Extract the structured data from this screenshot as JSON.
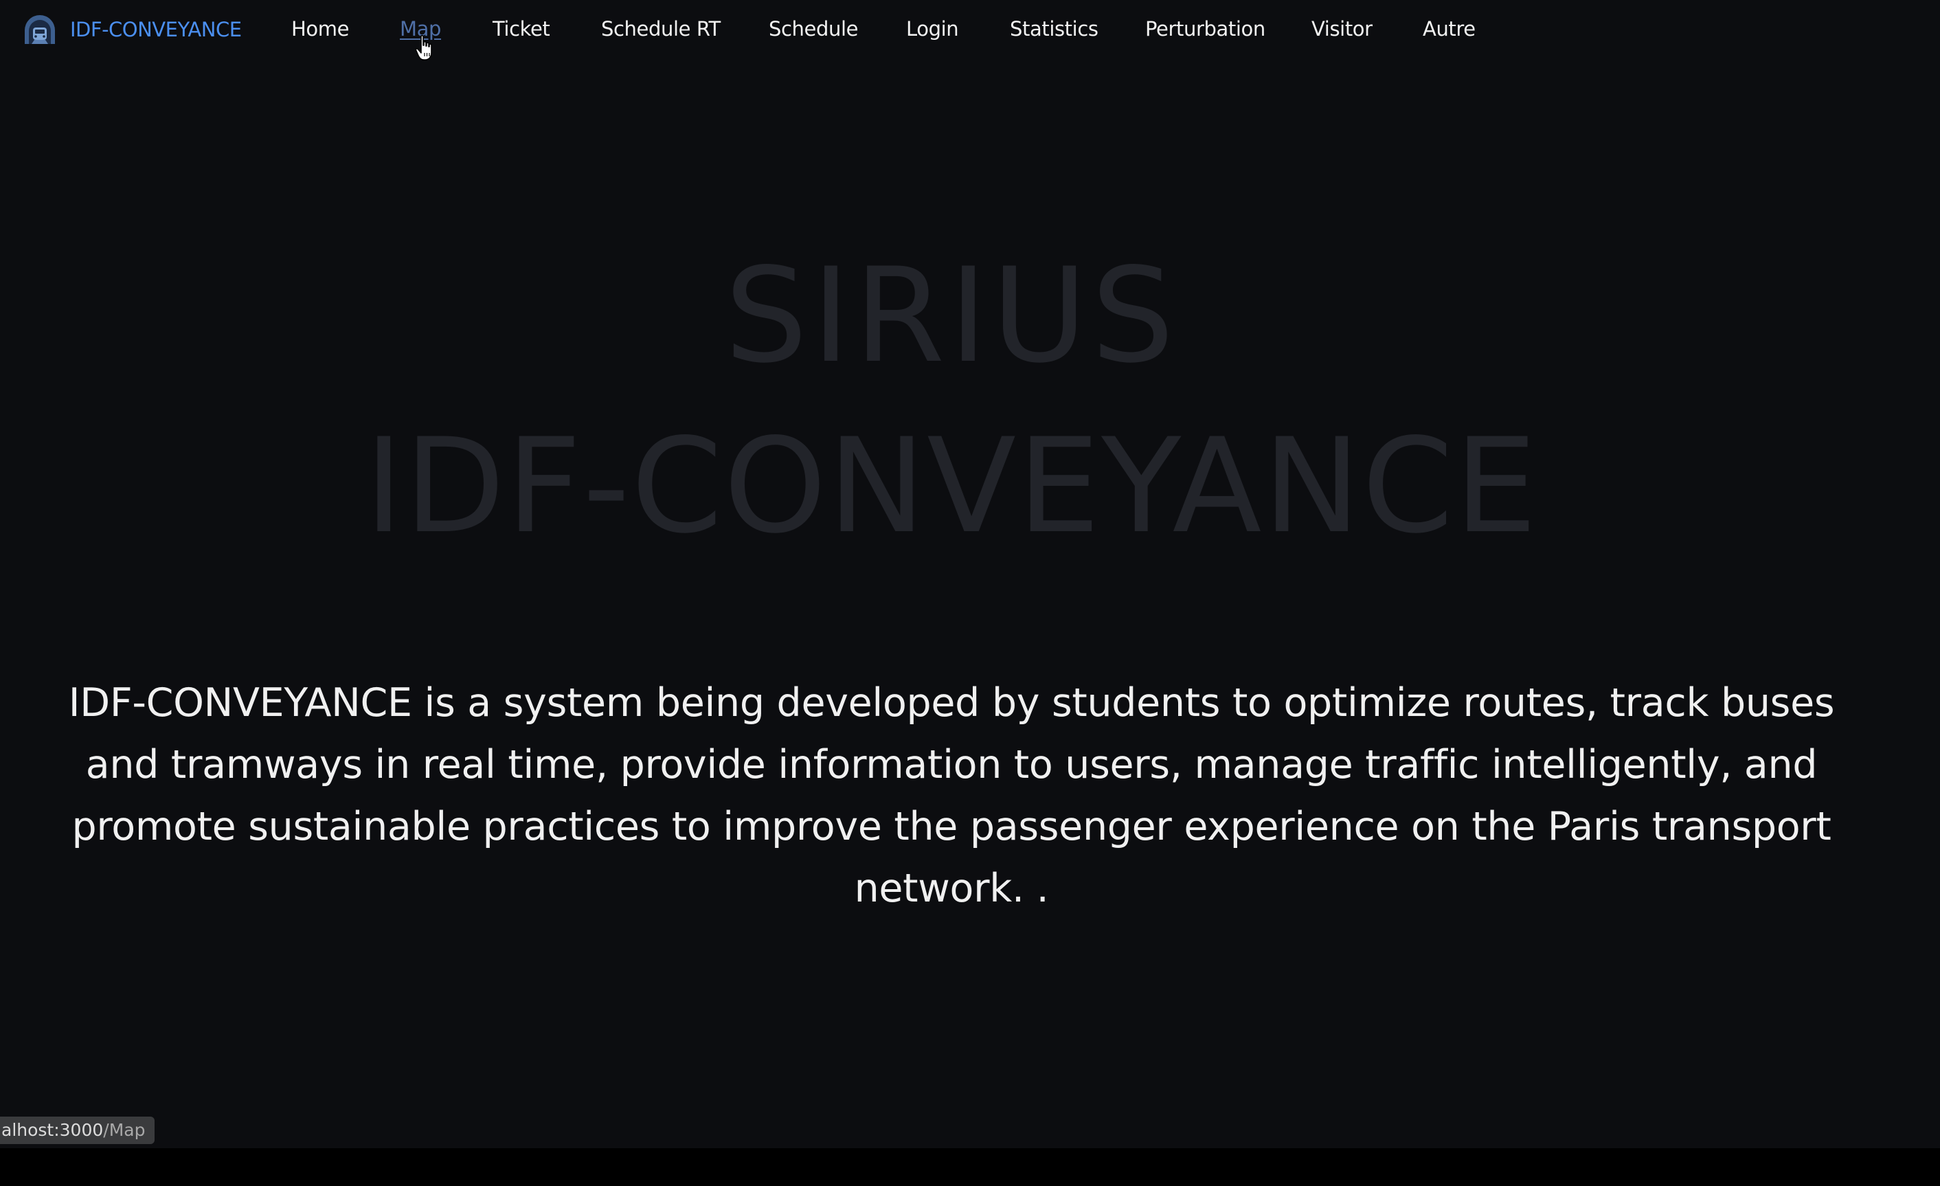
{
  "brand": {
    "name": "IDF-CONVEYANCE",
    "logo_icon": "metro-tunnel-logo-icon",
    "color": "#4b8ff0"
  },
  "nav": {
    "items": [
      {
        "label": "Home"
      },
      {
        "label": "Map",
        "state": "hover"
      },
      {
        "label": "Ticket"
      },
      {
        "label": "Schedule RT"
      },
      {
        "label": "Schedule"
      },
      {
        "label": "Login"
      },
      {
        "label": "Statistics"
      },
      {
        "label": "Perturbation"
      },
      {
        "label": "Visitor"
      },
      {
        "label": "Autre"
      }
    ],
    "hover_color": "#4f6fa6"
  },
  "hero": {
    "title_line1": "SIRIUS",
    "title_line2": "IDF-CONVEYANCE",
    "title_color": "#22242a"
  },
  "description": {
    "lines": [
      "IDF-CONVEYANCE is a system being developed by students to optimize routes, track buses",
      "and tramways in real time, provide information to users, manage traffic intelligently, and",
      "promote sustainable practices to improve the passenger experience on the Paris transport",
      "network. ."
    ]
  },
  "status_bar": {
    "host": "alhost:3000",
    "path": "/Map"
  },
  "colors": {
    "background": "#0c0d10",
    "text": "#f0f0f0"
  }
}
